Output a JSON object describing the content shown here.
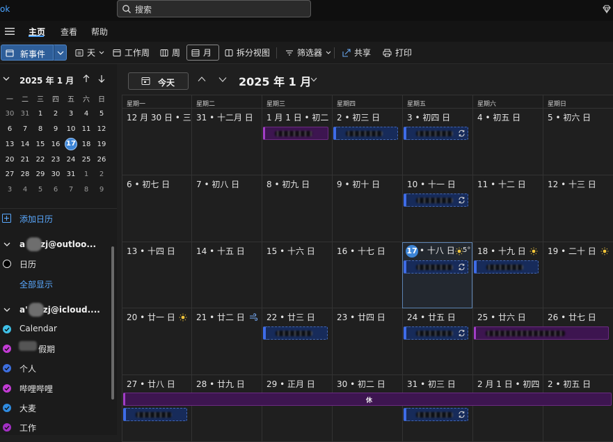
{
  "app": {
    "name_fragment": "ok"
  },
  "search": {
    "placeholder": "搜索"
  },
  "menu": {
    "tabs": [
      "主页",
      "查看",
      "帮助"
    ]
  },
  "toolbar": {
    "new_event": "新事件",
    "day": "天",
    "work_week": "工作周",
    "week": "周",
    "month": "月",
    "split_view": "拆分视图",
    "filter": "筛选器",
    "share": "共享",
    "print": "打印"
  },
  "mini_calendar": {
    "title": "2025 年 1 月",
    "weekday_headers": [
      "一",
      "二",
      "三",
      "四",
      "五",
      "六",
      "日"
    ],
    "weeks": [
      [
        "30",
        "31",
        "1",
        "2",
        "3",
        "4",
        "5"
      ],
      [
        "6",
        "7",
        "8",
        "9",
        "10",
        "11",
        "12"
      ],
      [
        "13",
        "14",
        "15",
        "16",
        "17",
        "18",
        "19"
      ],
      [
        "20",
        "21",
        "22",
        "23",
        "24",
        "25",
        "26"
      ],
      [
        "27",
        "28",
        "29",
        "30",
        "31",
        "1",
        "2"
      ],
      [
        "3",
        "4",
        "5",
        "6",
        "7",
        "8",
        "9"
      ]
    ],
    "today": "17"
  },
  "sidebar": {
    "add_calendar": "添加日历",
    "accounts": [
      {
        "name_prefix": "a",
        "name_suffix": "zj@outloo...",
        "calendars": [
          {
            "label": "日历",
            "color": "#000000",
            "style": "ring"
          }
        ],
        "show_all": "全部显示"
      },
      {
        "name_prefix": "a'",
        "name_suffix": "zj@icloud....",
        "calendars": [
          {
            "label": "Calendar",
            "color": "#3fc1e8"
          },
          {
            "label": "假期",
            "color": "#c23bd4"
          },
          {
            "label": "个人",
            "color": "#3d6fe0"
          },
          {
            "label": "哔哩哔哩",
            "color": "#c23bd4"
          },
          {
            "label": "大麦",
            "color": "#2f8be0"
          },
          {
            "label": "工作",
            "color": "#a32fc4"
          }
        ]
      }
    ]
  },
  "main": {
    "today_button": "今天",
    "title": "2025 年 1 月",
    "weekday_headers": [
      "星期一",
      "星期二",
      "星期三",
      "星期四",
      "星期五",
      "星期六",
      "星期日"
    ],
    "weeks": [
      [
        "12 月 30 日 • 三...",
        "31 • 十二月 日",
        "1 月 1 日 • 初二 日",
        "2 • 初三 日",
        "3 • 初四 日",
        "4 • 初五 日",
        "5 • 初六 日"
      ],
      [
        "6 • 初七 日",
        "7 • 初八 日",
        "8 • 初九 日",
        "9 • 初十 日",
        "10 • 十一 日",
        "11 • 十二 日",
        "12 • 十三 日"
      ],
      [
        "13 • 十四 日",
        "14 • 十五 日",
        "15 • 十六 日",
        "16 • 十七 日",
        "• 十八 日",
        "18 • 十九 日",
        "19 • 二十 日"
      ],
      [
        "20 • 廿一 日",
        "21 • 廿二 日",
        "22 • 廿三 日",
        "23 • 廿四 日",
        "24 • 廿五 日",
        "25 • 廿六 日",
        "26 • 廿七 日"
      ],
      [
        "27 • 廿八 日",
        "28 • 廿九 日",
        "29 • 正月 日",
        "30 • 初二 日",
        "31 • 初三 日",
        "2 月 1 日 • 初四 日",
        "2 • 初五 日"
      ]
    ],
    "today_number": "17",
    "today_temp": "5°",
    "holiday_label": "休"
  },
  "colors": {
    "accent": "#3d85d6",
    "event_blue": "#172b5a",
    "event_purple": "#3d1550"
  }
}
